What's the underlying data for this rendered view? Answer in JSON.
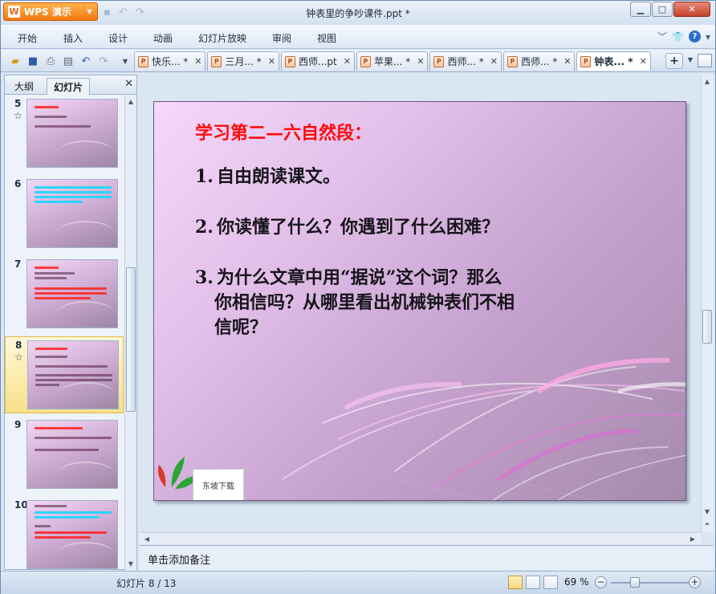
{
  "app": {
    "menu_button": "WPS 演示",
    "window_title": "钟表里的争吵课件.ppt *"
  },
  "menu": [
    "开始",
    "插入",
    "设计",
    "动画",
    "幻灯片放映",
    "审阅",
    "视图"
  ],
  "doc_tabs": [
    {
      "label": "快乐... *",
      "active": false
    },
    {
      "label": "三月... *",
      "active": false
    },
    {
      "label": "西师...pt",
      "active": false
    },
    {
      "label": "苹果... *",
      "active": false
    },
    {
      "label": "西师... *",
      "active": false
    },
    {
      "label": "西师... *",
      "active": false
    },
    {
      "label": "钟表... *",
      "active": true
    }
  ],
  "panel": {
    "tab_outline": "大纲",
    "tab_slides": "幻灯片",
    "thumbnails": [
      {
        "num": "5",
        "star": true
      },
      {
        "num": "6",
        "star": false
      },
      {
        "num": "7",
        "star": false
      },
      {
        "num": "8",
        "star": true,
        "selected": true
      },
      {
        "num": "9",
        "star": false
      },
      {
        "num": "10",
        "star": false
      }
    ]
  },
  "slide": {
    "title": "学习第二—六自然段：",
    "points": [
      {
        "n": "1.",
        "text": "自由朗读课文。"
      },
      {
        "n": "2.",
        "text": "你读懂了什么？你遇到了什么困难？"
      },
      {
        "n": "3.",
        "text": "为什么文章中用“据说”这个词？那么",
        "cont": [
          "你相信吗？从哪里看出机械钟表们不相",
          "信呢？"
        ]
      }
    ],
    "tag_label": "东坡下载"
  },
  "notes_placeholder": "单击添加备注",
  "status": {
    "slide_counter": "幻灯片 8 / 13",
    "zoom": "69 %"
  }
}
